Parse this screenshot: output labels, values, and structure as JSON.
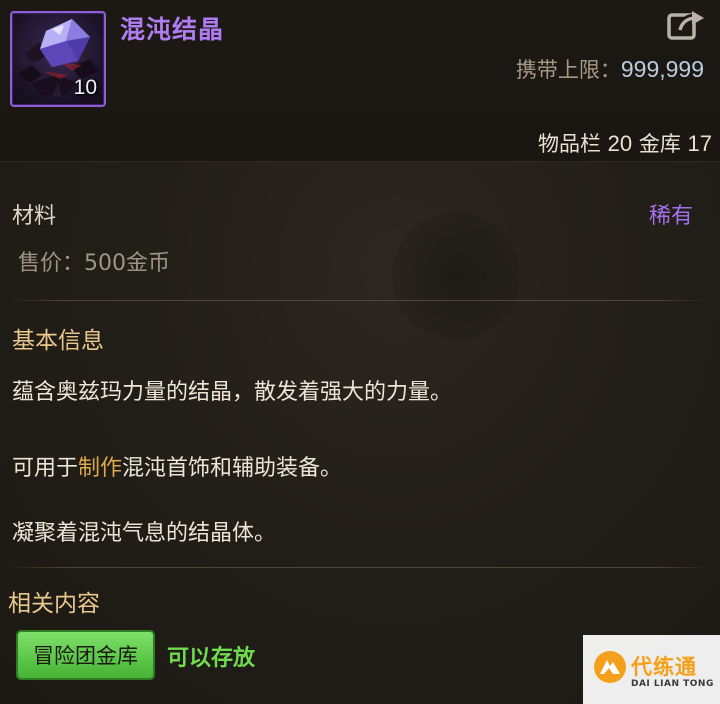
{
  "item": {
    "name": "混沌结晶",
    "count": "10",
    "icon": "crystal-icon"
  },
  "header": {
    "limit_label": "携带上限：",
    "limit_value": "999,999",
    "inventory_label": "物品栏",
    "inventory_count": "20",
    "vault_label": "金库",
    "vault_count": "17",
    "share_icon": "share-icon"
  },
  "info": {
    "category": "材料",
    "rarity": "稀有",
    "price": "售价：500金币"
  },
  "basic": {
    "title": "基本信息",
    "line1": "蕴含奥兹玛力量的结晶，散发着强大的力量。",
    "line2_prefix": "可用于",
    "line2_highlight": "制作",
    "line2_suffix": "混沌首饰和辅助装备。",
    "line3": "凝聚着混沌气息的结晶体。"
  },
  "related": {
    "title": "相关内容",
    "button_label": "冒险团金库",
    "status": "可以存放"
  },
  "watermark": {
    "cn": "代练通",
    "en": "DAI LIAN TONG"
  },
  "colors": {
    "item_name": "#b07cf2",
    "rarity": "#a66ff0",
    "section_title": "#e9c88e",
    "highlight": "#e0a84c",
    "button_green": "#5ec84a",
    "status_green": "#6fdc4e"
  }
}
